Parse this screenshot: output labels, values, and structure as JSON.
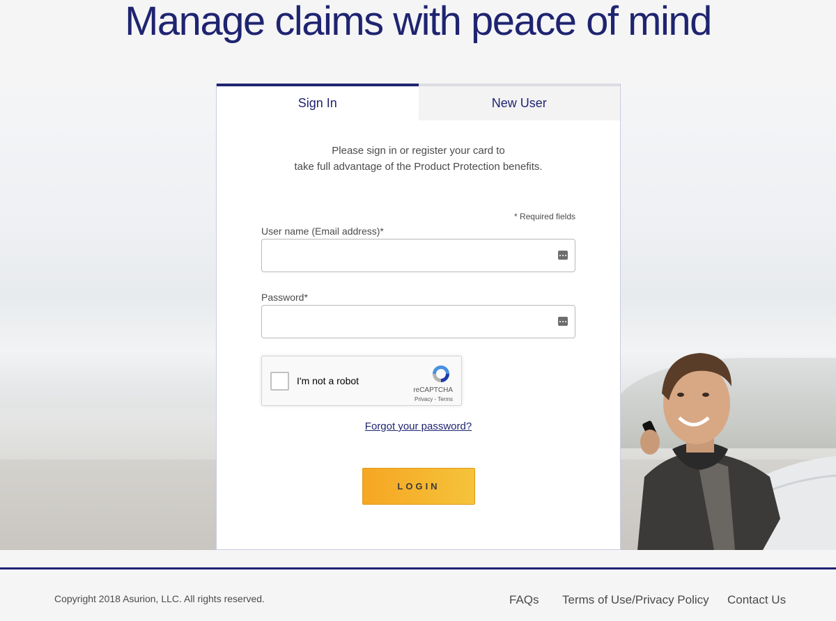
{
  "hero": {
    "title": "Manage claims with peace of mind"
  },
  "tabs": [
    {
      "label": "Sign In",
      "active": true
    },
    {
      "label": "New User",
      "active": false
    }
  ],
  "intro": {
    "line1": "Please sign in or register your card to",
    "line2": "take full advantage of the Product Protection benefits."
  },
  "form": {
    "required_note": "* Required fields",
    "username_label": "User name (Email address)*",
    "username_value": "",
    "password_label": "Password*",
    "password_value": "",
    "autofill_icon": "password-manager-icon"
  },
  "captcha": {
    "label": "I'm not a robot",
    "brand": "reCAPTCHA",
    "terms": "Privacy - Terms",
    "checked": false
  },
  "forgot_link": "Forgot your password?",
  "login_button": "LOGIN",
  "footer": {
    "copyright": "Copyright 2018 Asurion, LLC. All rights reserved.",
    "links": [
      "FAQs",
      "Terms of Use/Privacy Policy",
      "Contact Us"
    ]
  },
  "colors": {
    "brand_navy": "#1f2470",
    "button_orange": "#f6a623",
    "button_yellow": "#f5c33a"
  }
}
